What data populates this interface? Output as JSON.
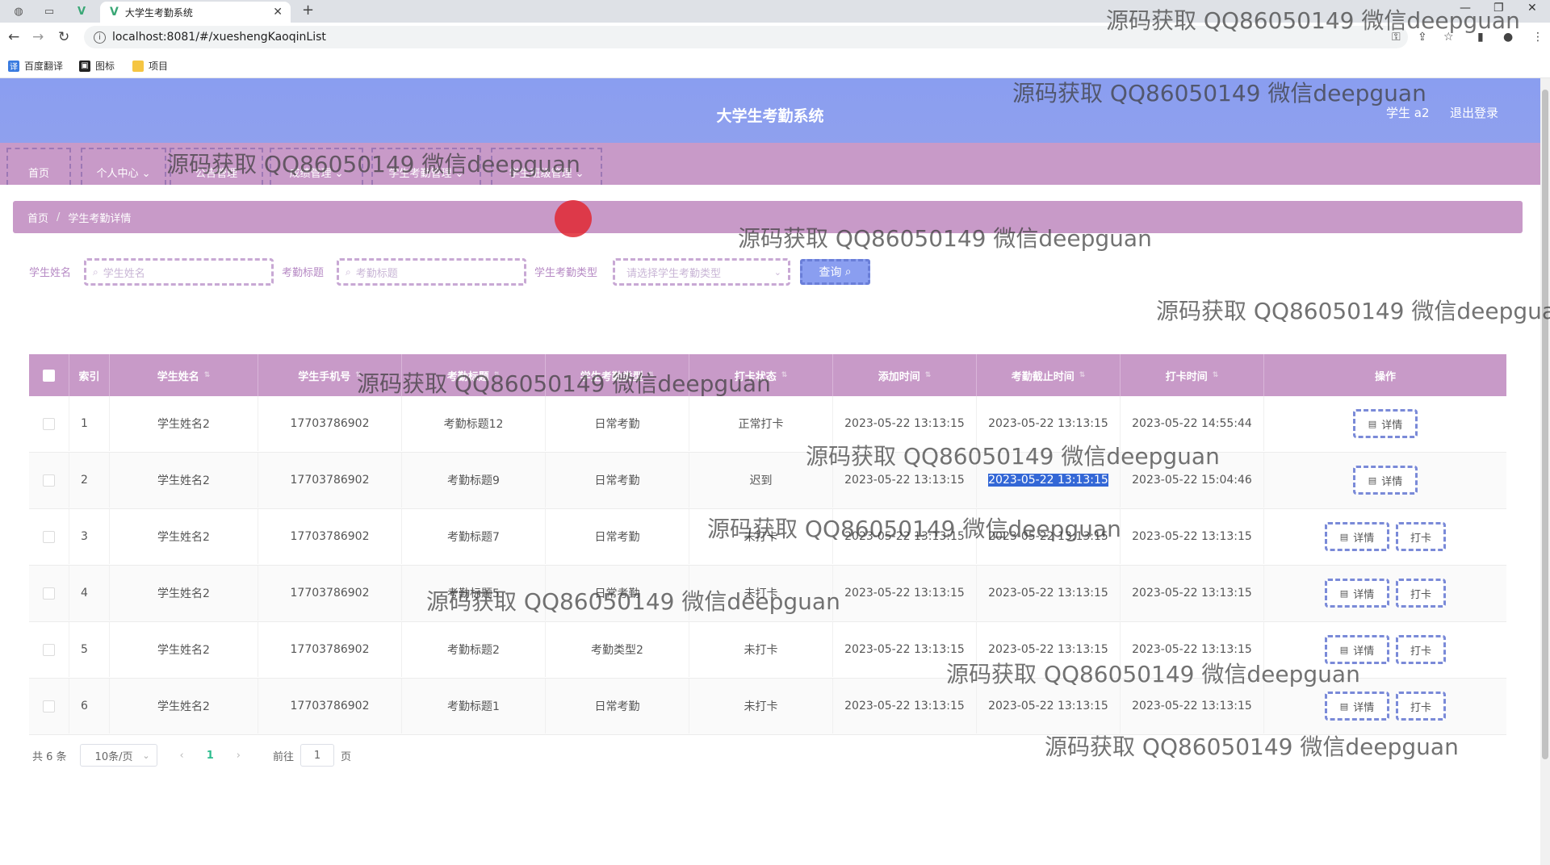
{
  "browser": {
    "tab_title": "大学生考勤系统",
    "url": "localhost:8081/#/xueshengKaoqinList",
    "bookmarks": [
      "百度翻译",
      "图标",
      "项目"
    ]
  },
  "app": {
    "title": "大学生考勤系统",
    "user": "学生 a2",
    "logout": "退出登录"
  },
  "nav": [
    "首页",
    "个人中心",
    "公告管理",
    "成绩管理",
    "学生考勤管理",
    "学生班级管理"
  ],
  "breadcrumb": {
    "home": "首页",
    "current": "学生考勤详情"
  },
  "search": {
    "name_label": "学生姓名",
    "name_placeholder": "学生姓名",
    "title_label": "考勤标题",
    "title_placeholder": "考勤标题",
    "type_label": "学生考勤类型",
    "type_placeholder": "请选择学生考勤类型",
    "query": "查询"
  },
  "table": {
    "headers": [
      "索引",
      "学生姓名",
      "学生手机号",
      "考勤标题",
      "学生考勤类型",
      "打卡状态",
      "添加时间",
      "考勤截止时间",
      "打卡时间",
      "操作"
    ],
    "rows": [
      {
        "idx": "1",
        "name": "学生姓名2",
        "phone": "17703786902",
        "title": "考勤标题12",
        "type": "日常考勤",
        "status": "正常打卡",
        "added": "2023-05-22 13:13:15",
        "deadline": "2023-05-22 13:13:15",
        "punch": "2023-05-22 14:55:44"
      },
      {
        "idx": "2",
        "name": "学生姓名2",
        "phone": "17703786902",
        "title": "考勤标题9",
        "type": "日常考勤",
        "status": "迟到",
        "added": "2023-05-22 13:13:15",
        "deadline": "2023-05-22 13:13:15",
        "punch": "2023-05-22 15:04:46"
      },
      {
        "idx": "3",
        "name": "学生姓名2",
        "phone": "17703786902",
        "title": "考勤标题7",
        "type": "日常考勤",
        "status": "未打卡",
        "added": "2023-05-22 13:13:15",
        "deadline": "2023-05-22 13:13:15",
        "punch": "2023-05-22 13:13:15"
      },
      {
        "idx": "4",
        "name": "学生姓名2",
        "phone": "17703786902",
        "title": "考勤标题5",
        "type": "日常考勤",
        "status": "未打卡",
        "added": "2023-05-22 13:13:15",
        "deadline": "2023-05-22 13:13:15",
        "punch": "2023-05-22 13:13:15"
      },
      {
        "idx": "5",
        "name": "学生姓名2",
        "phone": "17703786902",
        "title": "考勤标题2",
        "type": "考勤类型2",
        "status": "未打卡",
        "added": "2023-05-22 13:13:15",
        "deadline": "2023-05-22 13:13:15",
        "punch": "2023-05-22 13:13:15"
      },
      {
        "idx": "6",
        "name": "学生姓名2",
        "phone": "17703786902",
        "title": "考勤标题1",
        "type": "日常考勤",
        "status": "未打卡",
        "added": "2023-05-22 13:13:15",
        "deadline": "2023-05-22 13:13:15",
        "punch": "2023-05-22 13:13:15"
      }
    ],
    "detail_label": "详情",
    "punch_label": "打卡"
  },
  "pager": {
    "total": "共 6 条",
    "size": "10条/页",
    "current": "1",
    "goto": "前往",
    "goto_value": "1",
    "page": "页"
  },
  "watermark": "源码获取 QQ86050149 微信deepguan"
}
